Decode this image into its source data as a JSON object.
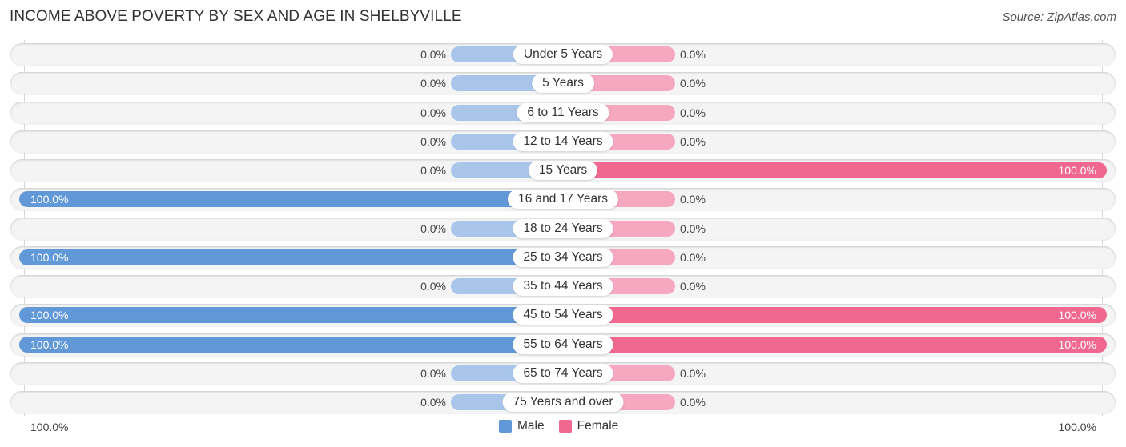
{
  "header": {
    "title": "INCOME ABOVE POVERTY BY SEX AND AGE IN SHELBYVILLE",
    "source": "Source: ZipAtlas.com"
  },
  "axis": {
    "left_label": "100.0%",
    "right_label": "100.0%"
  },
  "legend": {
    "male_label": "Male",
    "female_label": "Female"
  },
  "colors": {
    "male": "#6199d8",
    "male_stub": "#a9c6ea",
    "female": "#f06890",
    "female_stub": "#f5a8c0"
  },
  "chart_data": {
    "type": "bar",
    "orientation": "horizontal-diverging",
    "title": "INCOME ABOVE POVERTY BY SEX AND AGE IN SHELBYVILLE",
    "xlabel": "",
    "ylabel": "",
    "xlim": [
      -100,
      100
    ],
    "legend_position": "bottom-center",
    "grid": false,
    "categories": [
      "Under 5 Years",
      "5 Years",
      "6 to 11 Years",
      "12 to 14 Years",
      "15 Years",
      "16 and 17 Years",
      "18 to 24 Years",
      "25 to 34 Years",
      "35 to 44 Years",
      "45 to 54 Years",
      "55 to 64 Years",
      "65 to 74 Years",
      "75 Years and over"
    ],
    "series": [
      {
        "name": "Male",
        "values": [
          0,
          0,
          0,
          0,
          0,
          100,
          0,
          100,
          0,
          100,
          100,
          0,
          0
        ],
        "labels": [
          "0.0%",
          "0.0%",
          "0.0%",
          "0.0%",
          "0.0%",
          "100.0%",
          "0.0%",
          "100.0%",
          "0.0%",
          "100.0%",
          "100.0%",
          "0.0%",
          "0.0%"
        ]
      },
      {
        "name": "Female",
        "values": [
          0,
          0,
          0,
          0,
          100,
          0,
          0,
          0,
          0,
          100,
          100,
          0,
          0
        ],
        "labels": [
          "0.0%",
          "0.0%",
          "0.0%",
          "0.0%",
          "100.0%",
          "0.0%",
          "0.0%",
          "0.0%",
          "0.0%",
          "100.0%",
          "100.0%",
          "0.0%",
          "0.0%"
        ]
      }
    ]
  }
}
